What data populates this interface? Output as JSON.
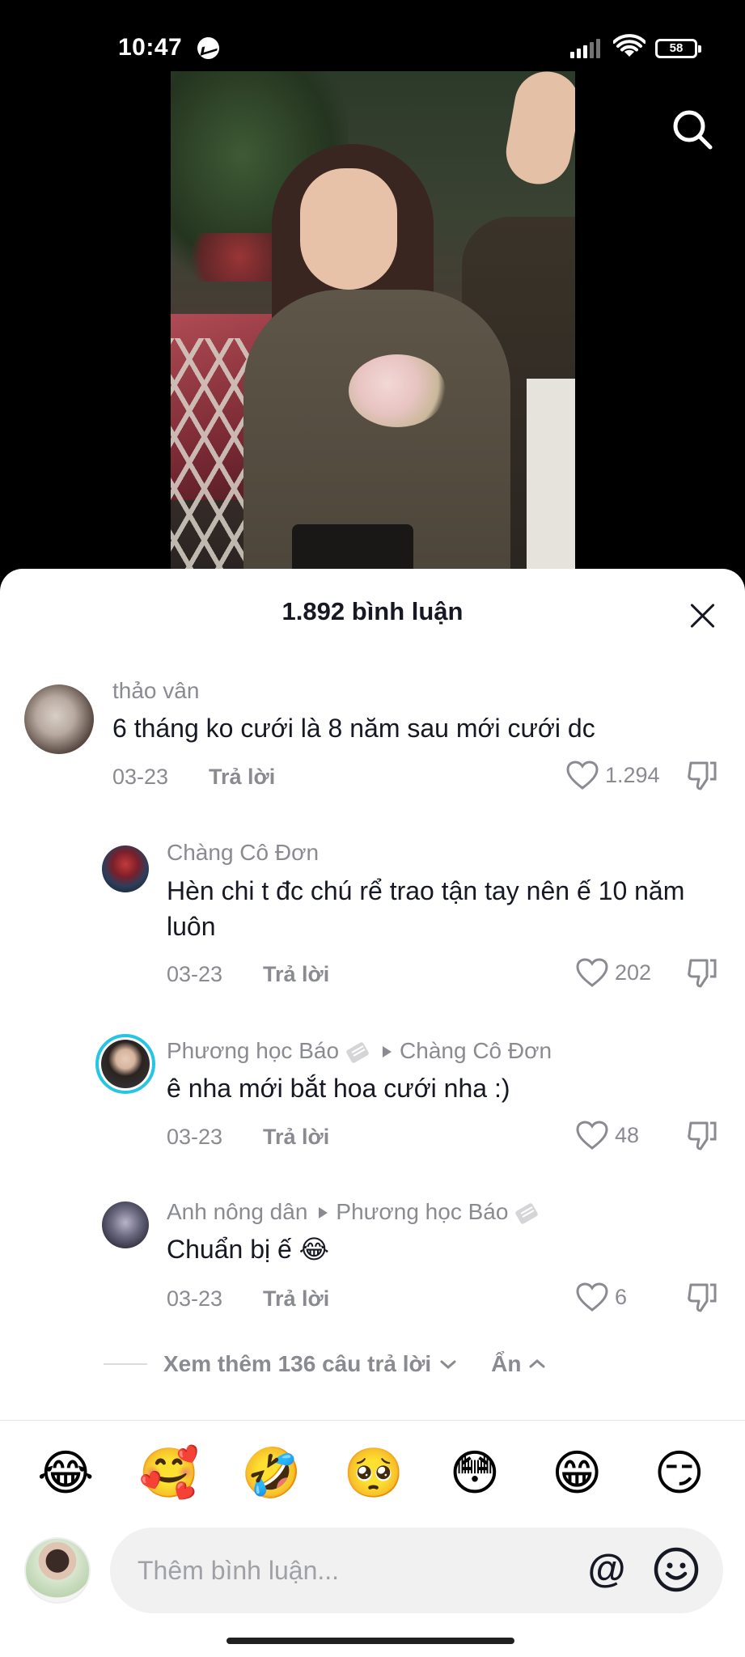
{
  "status_bar": {
    "time": "10:47",
    "battery": "58"
  },
  "sheet": {
    "title": "1.892 bình luận"
  },
  "comments": [
    {
      "user": "thảo vân",
      "text": "6 tháng ko cưới là 8 năm sau mới cưới dc",
      "date": "03-23",
      "reply": "Trả lời",
      "likes": "1.294"
    },
    {
      "user": "Chàng Cô Đơn",
      "text": "Hèn chi t đc chú rể trao tận tay nên ế 10 năm luôn",
      "date": "03-23",
      "reply": "Trả lời",
      "likes": "202"
    },
    {
      "user": "Phương học Báo",
      "reply_to": "Chàng Cô Đơn",
      "text": "ê nha mới bắt hoa cưới nha :)",
      "date": "03-23",
      "reply": "Trả lời",
      "likes": "48"
    },
    {
      "user": "Anh nông dân",
      "reply_to": "Phương học Báo",
      "text": "Chuẩn bị ế 😂",
      "date": "03-23",
      "reply": "Trả lời",
      "likes": "6"
    }
  ],
  "more_replies": {
    "label": "Xem thêm 136 câu trả lời",
    "hide_label": "Ẩn"
  },
  "emoji_bar": [
    "😂",
    "🥰",
    "🤣",
    "🥺",
    "😳",
    "😁",
    "😏"
  ],
  "input": {
    "placeholder": "Thêm bình luận...",
    "at_label": "@"
  }
}
